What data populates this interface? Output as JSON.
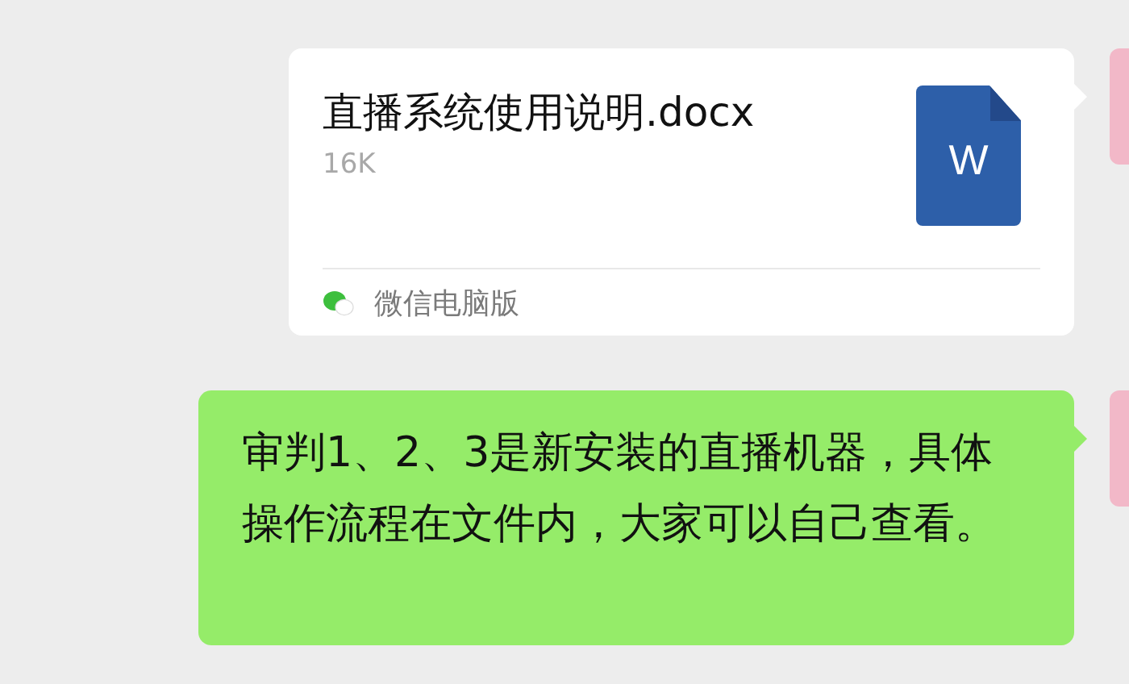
{
  "messages": [
    {
      "kind": "file",
      "file_name": "直播系统使用说明.docx",
      "size": "16K",
      "file_icon_letter": "W",
      "source": "微信电脑版"
    },
    {
      "kind": "text",
      "text": "审判1、2、3是新安装的直播机器，具体操作流程在文件内，大家可以自己查看。"
    }
  ]
}
